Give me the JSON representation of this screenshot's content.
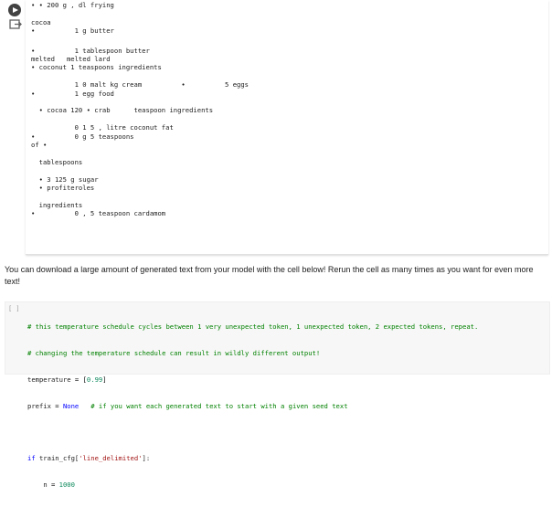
{
  "output": {
    "lines": [
      "• • 200 g , dl frying",
      "",
      "cocoa",
      "•          1 g butter",
      "•          1 tablespoon butter",
      "melted   melted lard",
      "• coconut 1 teaspoons ingredients",
      "",
      "           1 0 malt kg cream          •          5 eggs",
      "•          1 egg food",
      "",
      "  • cocoa 120 • crab      teaspoon ingredients",
      "",
      "           0 1 5 , litre coconut fat",
      "•          0 g 5 teaspoons",
      "of •",
      "",
      "  tablespoons",
      "",
      "  • 3 125 g sugar",
      "  • profiteroles",
      "",
      "  ingredients",
      "•          0 , 5 teaspoon cardamom"
    ]
  },
  "markdown": {
    "text": "You can download a large amount of generated text from your model with the cell below! Rerun the cell as many times as you want for even more text!"
  },
  "code_cell": {
    "bracket": "[ ]",
    "comment1": "# this temperature schedule cycles between 1 very unexpected token, 1 unexpected token, 2 expected tokens, repeat.",
    "comment2": "# changing the temperature schedule can result in wildly different output!",
    "temp_var": "temperature",
    "temp_value": "0.99",
    "prefix_var": "prefix",
    "prefix_value": "None",
    "prefix_comment": "# if you want each generated text to start with a given seed text",
    "if_kw": "if",
    "if_expr": "train_cfg[",
    "if_key": "'line_delimited'",
    "if_end": "]:",
    "n_var": "n",
    "n_value": "1000"
  }
}
